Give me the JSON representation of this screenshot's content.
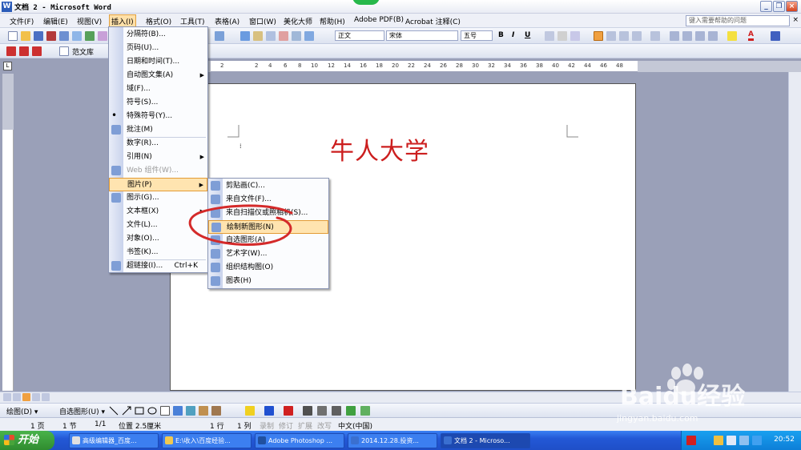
{
  "window": {
    "title": "文档 2 - Microsoft Word",
    "minimize": "_",
    "restore": "❐",
    "close": "×",
    "app_icon_letter": "W"
  },
  "menubar": {
    "items": [
      "文件(F)",
      "编辑(E)",
      "视图(V)",
      "插入(I)",
      "格式(O)",
      "工具(T)",
      "表格(A)",
      "窗口(W)",
      "美化大师",
      "帮助(H)",
      "Adobe PDF(B)",
      "Acrobat 注释(C)"
    ],
    "help_placeholder": "键入需要帮助的问题",
    "doc_close": "×"
  },
  "toolbar": {
    "style_value": "正文",
    "font_value": "宋体",
    "size_value": "五号",
    "bold": "B",
    "italic": "I",
    "underline": "U",
    "font_color": "A",
    "fan_wen_ku": "范文库"
  },
  "ruler": {
    "corner": "L",
    "ticks": [
      "2",
      "2",
      "4",
      "6",
      "8",
      "10",
      "12",
      "14",
      "16",
      "18",
      "20",
      "22",
      "24",
      "26",
      "28",
      "30",
      "32",
      "34",
      "36",
      "38",
      "40",
      "42",
      "44",
      "46",
      "48"
    ]
  },
  "document": {
    "heading": "牛人大学",
    "colors": {
      "heading": "#cc1e1e"
    }
  },
  "insert_menu": {
    "items": [
      {
        "label": "分隔符(B)...",
        "icon": "none"
      },
      {
        "label": "页码(U)...",
        "icon": "none"
      },
      {
        "label": "日期和时间(T)...",
        "icon": "none"
      },
      {
        "label": "自动图文集(A)",
        "icon": "none",
        "submenu": true
      },
      {
        "label": "域(F)...",
        "icon": "none"
      },
      {
        "label": "符号(S)...",
        "icon": "none"
      },
      {
        "label": "特殊符号(Y)...",
        "icon": "dot-icon"
      },
      {
        "label": "批注(M)",
        "icon": "comment-icon"
      },
      {
        "label": "数字(R)...",
        "icon": "none"
      },
      {
        "label": "引用(N)",
        "icon": "none",
        "submenu": true
      },
      {
        "label": "Web 组件(W)...",
        "icon": "web-icon",
        "disabled": true
      },
      {
        "label": "图片(P)",
        "icon": "none",
        "submenu": true,
        "highlighted": true
      },
      {
        "label": "图示(G)...",
        "icon": "diagram-icon"
      },
      {
        "label": "文本框(X)",
        "icon": "none",
        "submenu": true
      },
      {
        "label": "文件(L)...",
        "icon": "none"
      },
      {
        "label": "对象(O)...",
        "icon": "none"
      },
      {
        "label": "书签(K)...",
        "icon": "none"
      },
      {
        "label": "超链接(I)...",
        "icon": "hyperlink-icon",
        "shortcut": "Ctrl+K"
      }
    ]
  },
  "picture_submenu": {
    "items": [
      {
        "label": "剪贴画(C)...",
        "icon": "clipart-icon"
      },
      {
        "label": "来自文件(F)...",
        "icon": "from-file-icon"
      },
      {
        "label": "来自扫描仪或照相机(S)...",
        "icon": "scanner-icon"
      },
      {
        "label": "绘制新图形(N)",
        "icon": "new-drawing-icon",
        "highlighted": true
      },
      {
        "label": "自选图形(A)",
        "icon": "autoshape-icon"
      },
      {
        "label": "艺术字(W)...",
        "icon": "wordart-icon"
      },
      {
        "label": "组织结构图(O)",
        "icon": "org-chart-icon"
      },
      {
        "label": "图表(H)",
        "icon": "chart-icon"
      }
    ]
  },
  "drawbar": {
    "draw": "绘图(D) ▾",
    "autoshapes": "自选图形(U) ▾"
  },
  "statusbar": {
    "page": "1 页",
    "section": "1 节",
    "page_of": "1/1",
    "position": "位置 2.5厘米",
    "line": "1 行",
    "column": "1 列",
    "rec": "录制",
    "trk": "修订",
    "ext": "扩展",
    "ovr": "改写",
    "language": "中文(中国)"
  },
  "taskbar": {
    "start": "开始",
    "tasks": [
      "高级编辑器_百度...",
      "E:\\收入\\百度经验...",
      "Adobe Photoshop ...",
      "2014.12.28.投资...",
      "文档 2 - Microso..."
    ],
    "clock": "20:52"
  },
  "watermark": {
    "brand": "Baidu经验",
    "url": "jingyan.baidu.com"
  }
}
